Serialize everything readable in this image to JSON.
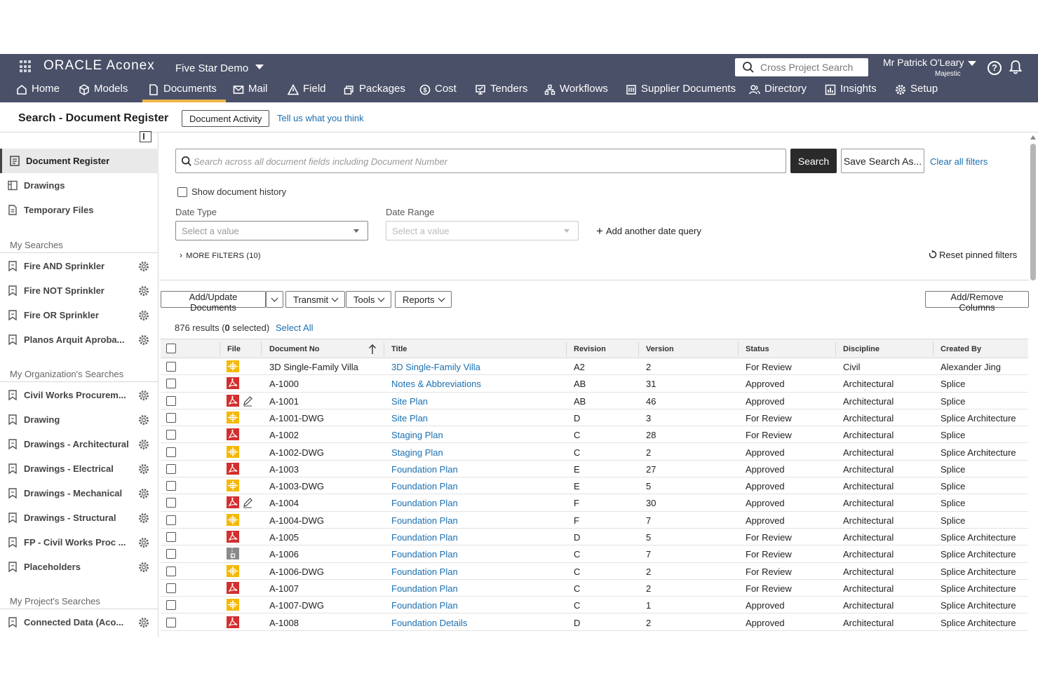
{
  "header": {
    "brand": "ORACLE Aconex",
    "project": "Five Star Demo",
    "cross_search_placeholder": "Cross Project Search",
    "user_name": "Mr Patrick O'Leary",
    "user_org": "Majestic",
    "help_label": "?"
  },
  "nav": [
    {
      "label": "Home",
      "icon": "home-icon"
    },
    {
      "label": "Models",
      "icon": "cube-icon"
    },
    {
      "label": "Documents",
      "icon": "document-icon",
      "active": true
    },
    {
      "label": "Mail",
      "icon": "mail-icon"
    },
    {
      "label": "Field",
      "icon": "warning-triangle-icon"
    },
    {
      "label": "Packages",
      "icon": "packages-icon"
    },
    {
      "label": "Cost",
      "icon": "dollar-icon"
    },
    {
      "label": "Tenders",
      "icon": "tender-icon"
    },
    {
      "label": "Workflows",
      "icon": "workflow-icon"
    },
    {
      "label": "Supplier Documents",
      "icon": "building-icon"
    },
    {
      "label": "Directory",
      "icon": "people-icon"
    },
    {
      "label": "Insights",
      "icon": "chart-icon"
    },
    {
      "label": "Setup",
      "icon": "gear-icon"
    }
  ],
  "page": {
    "title": "Search - Document Register",
    "activity_button": "Document Activity",
    "feedback_link": "Tell us what you think"
  },
  "sidebar": {
    "items": [
      {
        "label": "Document Register",
        "icon": "register-icon",
        "active": true
      },
      {
        "label": "Drawings",
        "icon": "drawings-icon"
      },
      {
        "label": "Temporary Files",
        "icon": "temp-file-icon"
      }
    ],
    "my_searches_title": "My Searches",
    "my_searches": [
      "Fire AND Sprinkler",
      "Fire NOT Sprinkler",
      "Fire OR Sprinkler",
      "Planos Arquit Aproba..."
    ],
    "org_searches_title": "My Organization's Searches",
    "org_searches": [
      "Civil Works Procurem...",
      "Drawing",
      "Drawings - Architectural",
      "Drawings - Electrical",
      "Drawings - Mechanical",
      "Drawings - Structural",
      "FP - Civil Works Proc ...",
      "Placeholders"
    ],
    "project_searches_title": "My Project's Searches",
    "project_searches": [
      "Connected Data (Aco..."
    ]
  },
  "search": {
    "placeholder": "Search across all document fields including Document Number",
    "search_button": "Search",
    "save_button": "Save Search As...",
    "clear_link": "Clear all filters",
    "history_label": "Show document history",
    "date_type_label": "Date Type",
    "date_type_value": "Select a value",
    "date_range_label": "Date Range",
    "date_range_value": "Select a value",
    "add_date": "Add another date query",
    "more_filters": "MORE FILTERS (10)",
    "reset_pinned": "Reset pinned filters"
  },
  "toolbar": {
    "add_update": "Add/Update Documents",
    "transmit": "Transmit",
    "tools": "Tools",
    "reports": "Reports",
    "add_remove_columns": "Add/Remove Columns"
  },
  "results": {
    "count": "876 results (",
    "selected": "0",
    "selected_suffix": " selected)",
    "select_all": "Select All"
  },
  "table": {
    "columns": [
      "File",
      "Document No",
      "Title",
      "Revision",
      "Version",
      "Status",
      "Discipline",
      "Created By"
    ],
    "rows": [
      {
        "file": "dwg",
        "edit": false,
        "doc_no": "3D Single-Family Villa",
        "title": "3D Single-Family Villa",
        "revision": "A2",
        "version": "2",
        "status": "For Review",
        "discipline": "Civil",
        "created_by": "Alexander Jing"
      },
      {
        "file": "pdf",
        "edit": false,
        "doc_no": "A-1000",
        "title": "Notes & Abbreviations",
        "revision": "AB",
        "version": "31",
        "status": "Approved",
        "discipline": "Architectural",
        "created_by": "Splice"
      },
      {
        "file": "pdf",
        "edit": true,
        "doc_no": "A-1001",
        "title": "Site Plan",
        "revision": "AB",
        "version": "46",
        "status": "Approved",
        "discipline": "Architectural",
        "created_by": "Splice"
      },
      {
        "file": "dwg",
        "edit": false,
        "doc_no": "A-1001-DWG",
        "title": "Site Plan",
        "revision": "D",
        "version": "3",
        "status": "For Review",
        "discipline": "Architectural",
        "created_by": "Splice Architecture"
      },
      {
        "file": "pdf",
        "edit": false,
        "doc_no": "A-1002",
        "title": "Staging Plan",
        "revision": "C",
        "version": "28",
        "status": "For Review",
        "discipline": "Architectural",
        "created_by": "Splice"
      },
      {
        "file": "dwg",
        "edit": false,
        "doc_no": "A-1002-DWG",
        "title": "Staging Plan",
        "revision": "C",
        "version": "2",
        "status": "Approved",
        "discipline": "Architectural",
        "created_by": "Splice Architecture"
      },
      {
        "file": "pdf",
        "edit": false,
        "doc_no": "A-1003",
        "title": "Foundation Plan",
        "revision": "E",
        "version": "27",
        "status": "Approved",
        "discipline": "Architectural",
        "created_by": "Splice"
      },
      {
        "file": "dwg",
        "edit": false,
        "doc_no": "A-1003-DWG",
        "title": "Foundation Plan",
        "revision": "E",
        "version": "5",
        "status": "Approved",
        "discipline": "Architectural",
        "created_by": "Splice"
      },
      {
        "file": "pdf",
        "edit": true,
        "doc_no": "A-1004",
        "title": "Foundation Plan",
        "revision": "F",
        "version": "30",
        "status": "Approved",
        "discipline": "Architectural",
        "created_by": "Splice"
      },
      {
        "file": "dwg",
        "edit": false,
        "doc_no": "A-1004-DWG",
        "title": "Foundation Plan",
        "revision": "F",
        "version": "7",
        "status": "Approved",
        "discipline": "Architectural",
        "created_by": "Splice"
      },
      {
        "file": "pdf",
        "edit": false,
        "doc_no": "A-1005",
        "title": "Foundation Plan",
        "revision": "D",
        "version": "5",
        "status": "For Review",
        "discipline": "Architectural",
        "created_by": "Splice Architecture"
      },
      {
        "file": "zip",
        "edit": false,
        "doc_no": "A-1006",
        "title": "Foundation Plan",
        "revision": "C",
        "version": "7",
        "status": "For Review",
        "discipline": "Architectural",
        "created_by": "Splice Architecture"
      },
      {
        "file": "dwg",
        "edit": false,
        "doc_no": "A-1006-DWG",
        "title": "Foundation Plan",
        "revision": "C",
        "version": "2",
        "status": "For Review",
        "discipline": "Architectural",
        "created_by": "Splice Architecture"
      },
      {
        "file": "pdf",
        "edit": false,
        "doc_no": "A-1007",
        "title": "Foundation Plan",
        "revision": "C",
        "version": "2",
        "status": "For Review",
        "discipline": "Architectural",
        "created_by": "Splice Architecture"
      },
      {
        "file": "dwg",
        "edit": false,
        "doc_no": "A-1007-DWG",
        "title": "Foundation Plan",
        "revision": "C",
        "version": "1",
        "status": "Approved",
        "discipline": "Architectural",
        "created_by": "Splice Architecture"
      },
      {
        "file": "pdf",
        "edit": false,
        "doc_no": "A-1008",
        "title": "Foundation Details",
        "revision": "D",
        "version": "2",
        "status": "Approved",
        "discipline": "Architectural",
        "created_by": "Splice Architecture"
      }
    ]
  },
  "colors": {
    "header_bg": "#4a5068",
    "active_tab_underline": "#f0b64a",
    "link": "#1a6fb0",
    "pdf_icon": "#d32f2f",
    "dwg_icon": "#f5b800",
    "zip_icon": "#8a8a8a"
  }
}
